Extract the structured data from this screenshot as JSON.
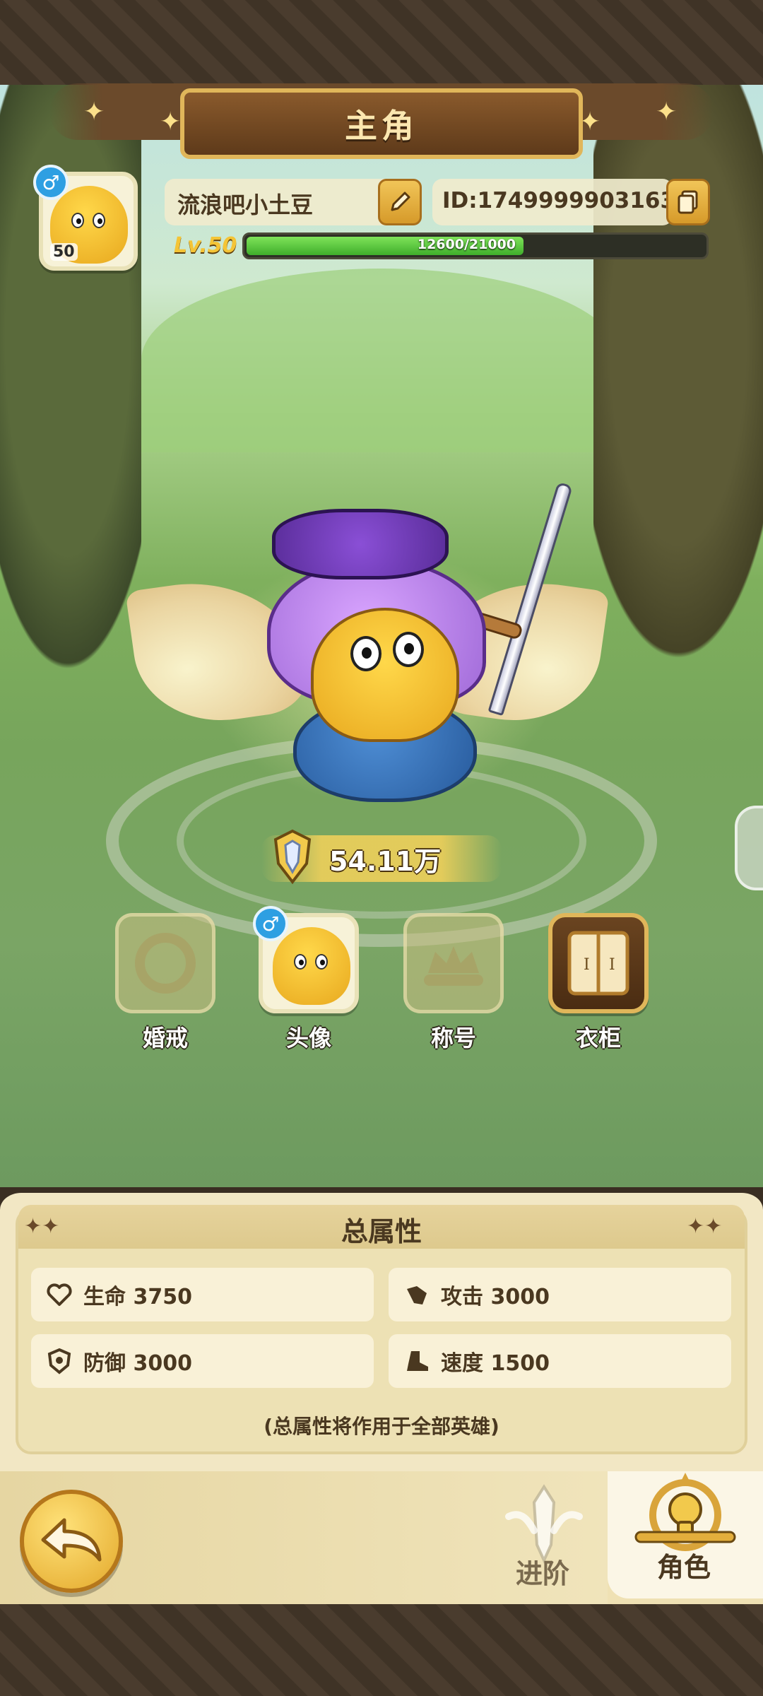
{
  "header": {
    "title": "主角"
  },
  "player": {
    "avatar_level": "50",
    "gender_symbol": "♂",
    "name": "流浪吧小土豆",
    "id_text": "ID:1749999903163",
    "level_text": "Lv.50",
    "exp_text": "12600/21000",
    "exp_current": 12600,
    "exp_max": 21000
  },
  "power": {
    "value": "54.11万"
  },
  "features": [
    {
      "label": "婚戒",
      "state": "locked"
    },
    {
      "label": "头像",
      "state": "active"
    },
    {
      "label": "称号",
      "state": "locked"
    },
    {
      "label": "衣柜",
      "state": "active"
    }
  ],
  "attributes": {
    "title": "总属性",
    "hp": "生命 3750",
    "attack": "攻击 3000",
    "defense": "防御 3000",
    "speed": "速度 1500",
    "note": "(总属性将作用于全部英雄)"
  },
  "nav": {
    "advance_label": "进阶",
    "role_label": "角色"
  },
  "colors": {
    "gold": "#e0b65a",
    "brown": "#4a3820",
    "exp_green": "#3fae2b",
    "gender_blue": "#2e9fe2"
  }
}
